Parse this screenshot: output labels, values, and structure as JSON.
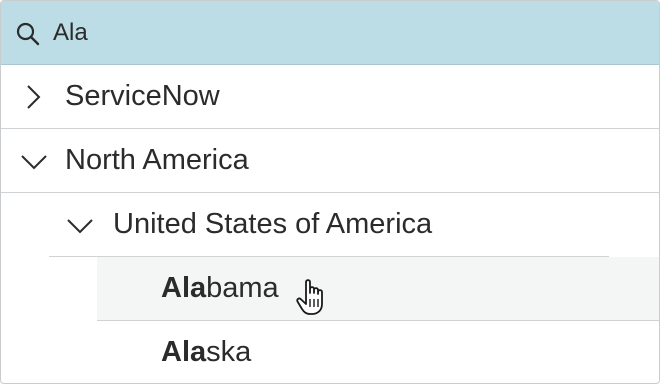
{
  "search": {
    "value": "Ala",
    "icon": "search-icon"
  },
  "tree": {
    "servicenow": {
      "label": "ServiceNow",
      "state": "collapsed"
    },
    "north_america": {
      "label": "North America",
      "state": "expanded"
    },
    "usa": {
      "label": "United States of America",
      "state": "expanded"
    },
    "alabama": {
      "match": "Ala",
      "rest": "bama",
      "hovered": true
    },
    "alaska": {
      "match": "Ala",
      "rest": "ska"
    }
  },
  "colors": {
    "search_bg": "#bcdde6",
    "hover_bg": "#f3f6f4",
    "divider": "#cfd3d6",
    "text": "#2b2b2b"
  },
  "cursor": "pointer-hand-icon"
}
